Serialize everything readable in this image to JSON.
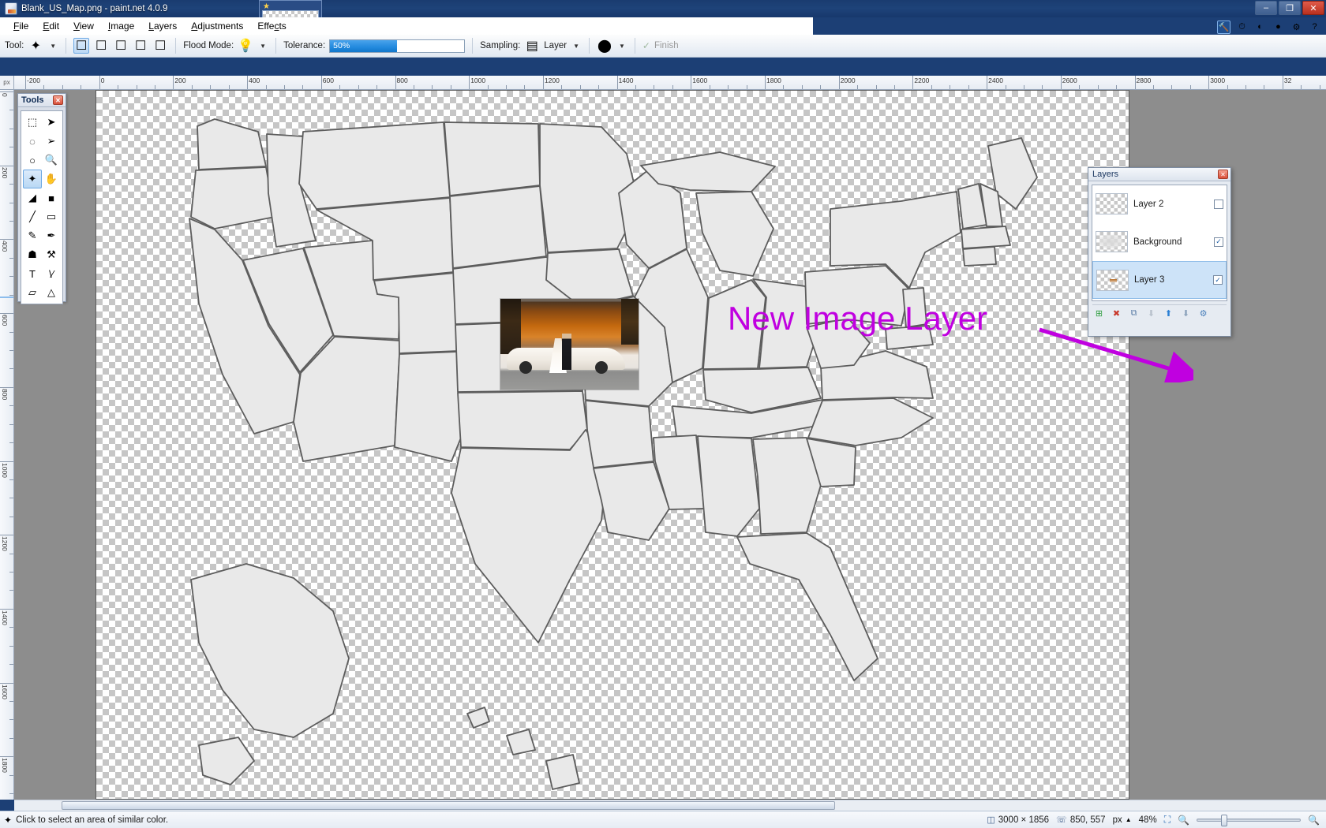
{
  "window": {
    "title": "Blank_US_Map.png - paint.net 4.0.9",
    "minimize_label": "–",
    "maximize_label": "❐",
    "close_label": "✕"
  },
  "menu": {
    "items": [
      {
        "label": "File"
      },
      {
        "label": "Edit"
      },
      {
        "label": "View"
      },
      {
        "label": "Image"
      },
      {
        "label": "Layers"
      },
      {
        "label": "Adjustments"
      },
      {
        "label": "Effects"
      }
    ]
  },
  "top_icons": [
    {
      "name": "settings-hammer-icon",
      "glyph": "🔨"
    },
    {
      "name": "history-clock-icon",
      "glyph": "⏱"
    },
    {
      "name": "palette-icon",
      "glyph": "◐"
    },
    {
      "name": "colors-icon",
      "glyph": "●"
    },
    {
      "name": "gear-icon",
      "glyph": "⚙"
    },
    {
      "name": "help-icon",
      "glyph": "?"
    }
  ],
  "options_bar": {
    "tool_label": "Tool:",
    "tool_icon": "magic-wand-icon",
    "selection_modes": [
      "replace",
      "union",
      "exclude",
      "xor",
      "intersect"
    ],
    "selection_active_index": 0,
    "flood_mode_label": "Flood Mode:",
    "flood_mode_icon": "flood-local-icon",
    "tolerance_label": "Tolerance:",
    "tolerance_value": "50%",
    "tolerance_percent": 50,
    "sampling_label": "Sampling:",
    "sampling_value": "Layer",
    "antialias_icon": "antialiasing-icon",
    "finish_label": "Finish"
  },
  "tools": {
    "title": "Tools",
    "close_label": "✕",
    "items": [
      {
        "name": "rectangle-select-tool",
        "glyph": "⬚"
      },
      {
        "name": "move-selected-tool",
        "glyph": "➤"
      },
      {
        "name": "lasso-select-tool",
        "glyph": "◌"
      },
      {
        "name": "move-selection-tool",
        "glyph": "➢"
      },
      {
        "name": "ellipse-select-tool",
        "glyph": "○"
      },
      {
        "name": "zoom-tool",
        "glyph": "🔍"
      },
      {
        "name": "magic-wand-tool",
        "glyph": "✦"
      },
      {
        "name": "pan-tool",
        "glyph": "✋"
      },
      {
        "name": "paint-bucket-tool",
        "glyph": "◢"
      },
      {
        "name": "gradient-tool",
        "glyph": "■"
      },
      {
        "name": "paintbrush-tool",
        "glyph": "╱"
      },
      {
        "name": "eraser-tool",
        "glyph": "▭"
      },
      {
        "name": "pencil-tool",
        "glyph": "✎"
      },
      {
        "name": "color-picker-tool",
        "glyph": "✒"
      },
      {
        "name": "clone-stamp-tool",
        "glyph": "☗"
      },
      {
        "name": "recolor-tool",
        "glyph": "⚒"
      },
      {
        "name": "text-tool",
        "glyph": "T"
      },
      {
        "name": "line-curve-tool",
        "glyph": "\\⁄"
      },
      {
        "name": "shapes-tool",
        "glyph": "▱"
      },
      {
        "name": "freeform-shape-tool",
        "glyph": "△"
      }
    ],
    "selected_index": 6
  },
  "rulers": {
    "unit": "px",
    "horizontal_labels": [
      "-200",
      "0",
      "200",
      "400",
      "600",
      "800",
      "1000",
      "1200",
      "1400",
      "1600",
      "1800",
      "2000",
      "2200",
      "2400",
      "2600",
      "2800",
      "3000",
      "32"
    ],
    "vertical_labels": [
      "0",
      "200",
      "400",
      "600",
      "800",
      "1000",
      "1200",
      "1400",
      "1600",
      "1800"
    ]
  },
  "canvas": {
    "annotation_text": "New Image Layer",
    "annotation_color": "#c000e0"
  },
  "layers_panel": {
    "title": "Layers",
    "close_label": "✕",
    "items": [
      {
        "name": "Layer 2",
        "visible": false,
        "selected": false
      },
      {
        "name": "Background",
        "visible": true,
        "selected": false
      },
      {
        "name": "Layer 3",
        "visible": true,
        "selected": true
      }
    ],
    "toolbar": [
      {
        "name": "add-new-layer-button",
        "glyph": "⊞",
        "color": "#2f9e3f"
      },
      {
        "name": "delete-layer-button",
        "glyph": "✖",
        "color": "#c8372a"
      },
      {
        "name": "duplicate-layer-button",
        "glyph": "⧉",
        "color": "#5d7fa8"
      },
      {
        "name": "merge-layer-down-button",
        "glyph": "⬇",
        "color": "#b9c2cd"
      },
      {
        "name": "move-layer-up-button",
        "glyph": "⬆",
        "color": "#2a7fd4"
      },
      {
        "name": "move-layer-down-button",
        "glyph": "⬇",
        "color": "#8fa5bd"
      },
      {
        "name": "layer-properties-button",
        "glyph": "⚙",
        "color": "#4a80bb"
      }
    ]
  },
  "status_bar": {
    "hint_icon": "magic-wand-icon",
    "hint_text": "Click to select an area of similar color.",
    "image_size_icon": "image-size-icon",
    "image_size": "3000 × 1856",
    "cursor_icon": "cursor-position-icon",
    "cursor_position": "850, 557",
    "unit": "px",
    "unit_caret": "▲",
    "zoom_level": "48%",
    "fit_icon": "fit-to-window-icon",
    "zoom_out_icon": "zoom-out-icon",
    "zoom_in_icon": "zoom-in-icon"
  }
}
